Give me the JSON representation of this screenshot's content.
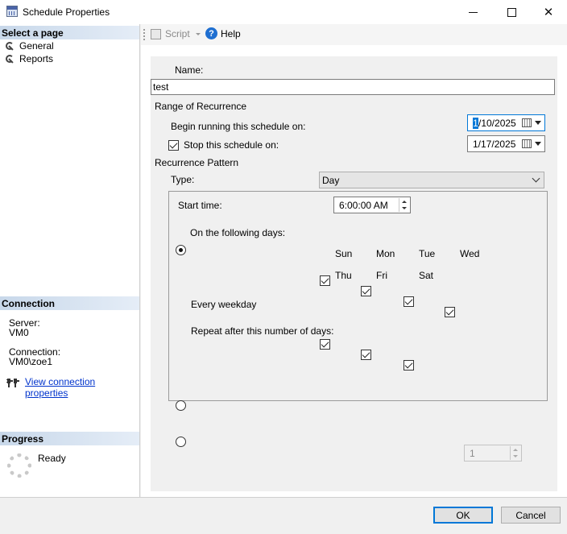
{
  "window": {
    "title": "Schedule Properties"
  },
  "left": {
    "select_page_header": "Select a page",
    "pages": [
      "General",
      "Reports"
    ],
    "connection_header": "Connection",
    "server_label": "Server:",
    "server_value": "VM0",
    "connection_label": "Connection:",
    "connection_value": "VM0\\zoe1",
    "view_link": "View connection properties",
    "progress_header": "Progress",
    "progress_status": "Ready"
  },
  "toolbar": {
    "script_label": "Script",
    "help_label": "Help"
  },
  "form": {
    "name_label": "Name:",
    "name_value": "test",
    "range_header": "Range of Recurrence",
    "begin_label": "Begin running this schedule on:",
    "begin_date_sel": "1",
    "begin_date_rest": "/10/2025",
    "stop_label": "Stop this schedule on:",
    "stop_checked": true,
    "stop_date": "1/17/2025",
    "pattern_header": "Recurrence Pattern",
    "type_label": "Type:",
    "type_value": "Day",
    "start_time_label": "Start time:",
    "start_time_value": "6:00:00 AM",
    "following_days_label": "On the following days:",
    "days": [
      {
        "label": "Sun",
        "checked": true
      },
      {
        "label": "Mon",
        "checked": true
      },
      {
        "label": "Tue",
        "checked": true
      },
      {
        "label": "Wed",
        "checked": true
      },
      {
        "label": "Thu",
        "checked": true
      },
      {
        "label": "Fri",
        "checked": true
      },
      {
        "label": "Sat",
        "checked": true
      }
    ],
    "every_weekday_label": "Every weekday",
    "repeat_label": "Repeat after this number of days:",
    "repeat_value": "1"
  },
  "buttons": {
    "ok": "OK",
    "cancel": "Cancel"
  }
}
